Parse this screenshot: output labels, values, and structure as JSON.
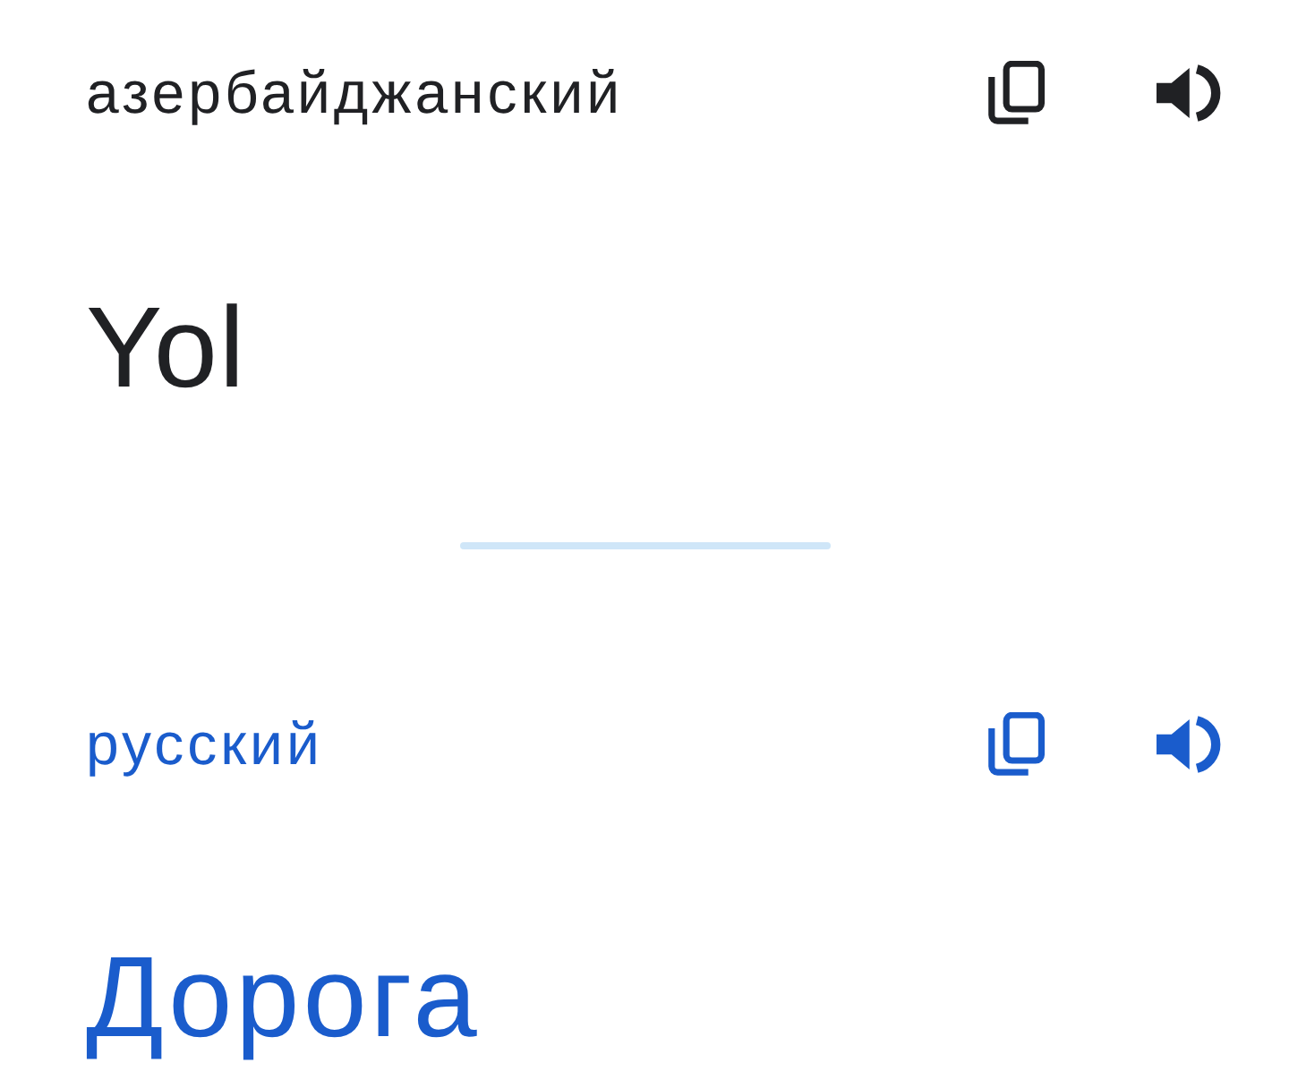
{
  "panels": [
    {
      "kind": "source",
      "language": "азербайджанский",
      "text": "Yol"
    },
    {
      "kind": "translation",
      "language": "русский",
      "text": "Дорога"
    }
  ]
}
